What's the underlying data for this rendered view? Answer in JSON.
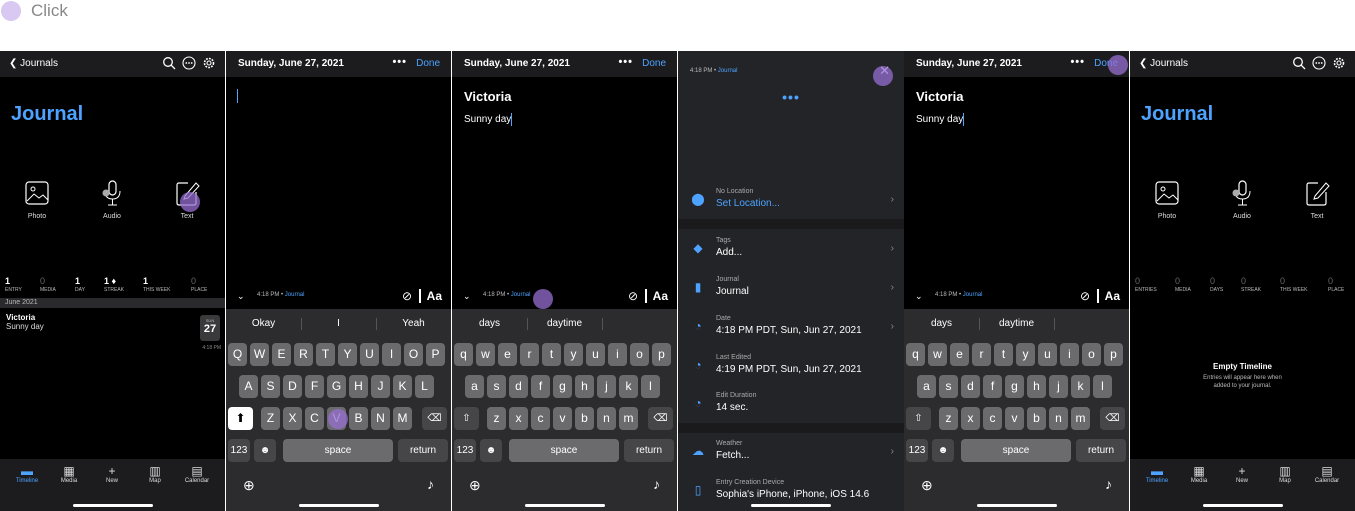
{
  "legend": {
    "label": "Click"
  },
  "journal_screen": {
    "back_label": "Journals",
    "title": "Journal",
    "media": [
      {
        "label": "Photo",
        "icon": "photo-icon"
      },
      {
        "label": "Audio",
        "icon": "microphone-icon"
      },
      {
        "label": "Text",
        "icon": "edit-icon"
      }
    ],
    "stats": [
      {
        "value": "1",
        "label": "ENTRY"
      },
      {
        "value": "0",
        "label": "MEDIA"
      },
      {
        "value": "1",
        "label": "DAY"
      },
      {
        "value": "1",
        "label": "STREAK"
      },
      {
        "value": "1",
        "label": "THIS WEEK"
      },
      {
        "value": "0",
        "label": "PLACE"
      }
    ],
    "month_header": "June 2021",
    "entry": {
      "title": "Victoria",
      "body": "Sunny day",
      "weekday": "SUN",
      "day": "27",
      "time": "4:18 PM"
    }
  },
  "empty_screen": {
    "back_label": "Journals",
    "title": "Journal",
    "stats": [
      {
        "value": "0",
        "label": "ENTRIES"
      },
      {
        "value": "0",
        "label": "MEDIA"
      },
      {
        "value": "0",
        "label": "DAYS"
      },
      {
        "value": "0",
        "label": "STREAK"
      },
      {
        "value": "0",
        "label": "THIS WEEK"
      },
      {
        "value": "0",
        "label": "PLACE"
      }
    ],
    "empty_title": "Empty Timeline",
    "empty_body_1": "Entries will appear here when",
    "empty_body_2": "added to your journal."
  },
  "tabs": [
    {
      "label": "Timeline",
      "icon": "timeline-icon"
    },
    {
      "label": "Media",
      "icon": "grid-icon"
    },
    {
      "label": "New",
      "icon": "plus-icon"
    },
    {
      "label": "Map",
      "icon": "map-icon"
    },
    {
      "label": "Calendar",
      "icon": "calendar-icon"
    }
  ],
  "editor": {
    "date": "Sunday, June 27, 2021",
    "more": "•••",
    "done": "Done",
    "entry_title": "Victoria",
    "entry_body": "Sunny day",
    "meta_time": "4:18 PM •",
    "meta_journal": "Journal",
    "aa": "Aa"
  },
  "keyboard_upper": {
    "suggestions": [
      "Okay",
      "I",
      "Yeah"
    ],
    "row1": [
      "Q",
      "W",
      "E",
      "R",
      "T",
      "Y",
      "U",
      "I",
      "O",
      "P"
    ],
    "row2": [
      "A",
      "S",
      "D",
      "F",
      "G",
      "H",
      "J",
      "K",
      "L"
    ],
    "row3": [
      "Z",
      "X",
      "C",
      "V",
      "B",
      "N",
      "M"
    ]
  },
  "keyboard_lower": {
    "suggestions": [
      "days",
      "daytime"
    ],
    "row1": [
      "q",
      "w",
      "e",
      "r",
      "t",
      "y",
      "u",
      "i",
      "o",
      "p"
    ],
    "row2": [
      "a",
      "s",
      "d",
      "f",
      "g",
      "h",
      "j",
      "k",
      "l"
    ],
    "row3": [
      "z",
      "x",
      "c",
      "v",
      "b",
      "n",
      "m"
    ]
  },
  "keyboard_common": {
    "numbers": "123",
    "space": "space",
    "return": "return"
  },
  "sheet": {
    "meta_time": "4:18 PM •",
    "meta_journal": "Journal",
    "more": "•••",
    "rows": [
      {
        "key": "No Location",
        "value": "Set Location...",
        "icon": "location-pin-icon"
      },
      {
        "key": "Tags",
        "value": "Add...",
        "icon": "tag-icon"
      },
      {
        "key": "Journal",
        "value": "Journal",
        "icon": "bookmark-icon"
      },
      {
        "key": "Date",
        "value": "4:18 PM PDT, Sun, Jun 27, 2021",
        "icon": "clock-icon"
      },
      {
        "key": "Last Edited",
        "value": "4:19 PM PDT, Sun, Jun 27, 2021",
        "icon": "clock-icon"
      },
      {
        "key": "Edit Duration",
        "value": "14 sec.",
        "icon": "clock-icon"
      },
      {
        "key": "Weather",
        "value": "Fetch...",
        "icon": "weather-icon"
      },
      {
        "key": "Entry Creation Device",
        "value": "Sophia's iPhone, iPhone, iOS 14.6",
        "icon": "phone-icon"
      }
    ]
  },
  "colors": {
    "accent": "#4da3ff",
    "click_marker": "#966ed2",
    "background": "#000000"
  }
}
